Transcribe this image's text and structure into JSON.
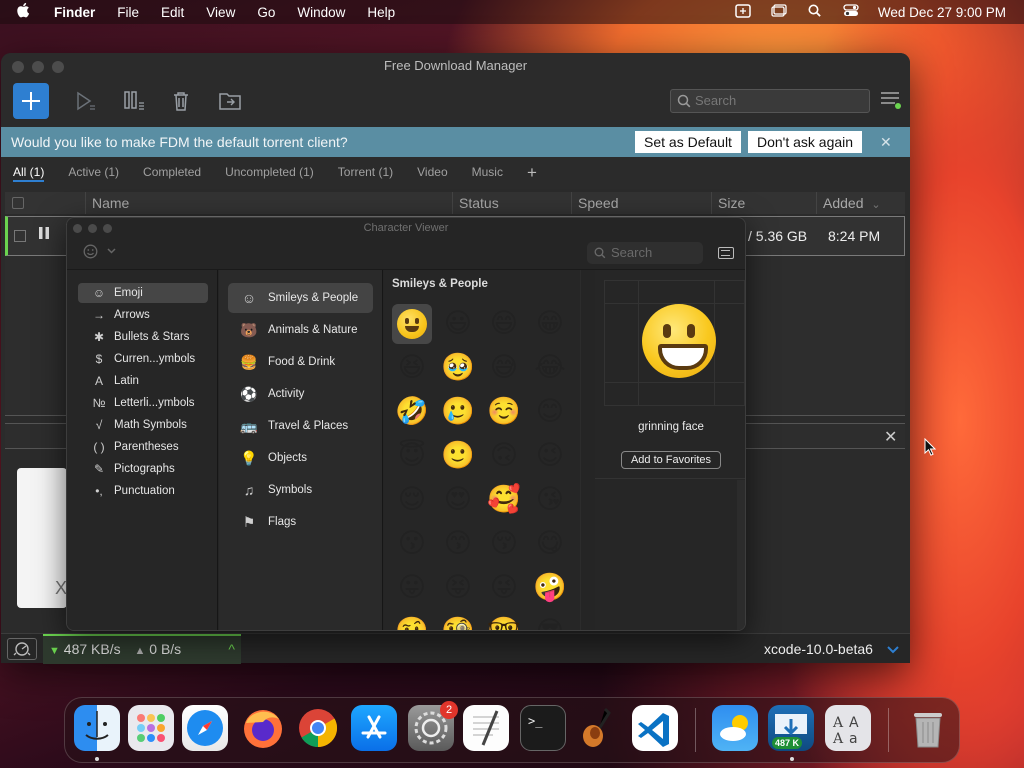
{
  "menubar": {
    "app_name": "Finder",
    "menus": [
      "File",
      "Edit",
      "View",
      "Go",
      "Window",
      "Help"
    ],
    "clock": "Wed Dec 27  9:00 PM",
    "status_icons": [
      "screen-mirror-icon",
      "window-icon",
      "search-icon",
      "control-center-icon"
    ]
  },
  "fdm": {
    "title": "Free Download Manager",
    "search_placeholder": "Search",
    "notice": {
      "text": "Would you like to make FDM the default torrent client?",
      "set_default": "Set as Default",
      "dont_ask": "Don't ask again",
      "close": "✕"
    },
    "tabs": [
      "All (1)",
      "Active (1)",
      "Completed",
      "Uncompleted (1)",
      "Torrent (1)",
      "Video",
      "Music"
    ],
    "tab_add": "+",
    "columns": [
      "Name",
      "Status",
      "Speed",
      "Size",
      "Added"
    ],
    "added_sort": "⌄",
    "row": {
      "size": "/ 5.36 GB",
      "added": "8:24 PM"
    },
    "detail_close": "✕",
    "detail_thumb_letter": "X",
    "statusbar": {
      "down": "487 KB/s",
      "up": "0 B/s",
      "file": "xcode-10.0-beta6"
    }
  },
  "char_viewer": {
    "title": "Character Viewer",
    "search_placeholder": "Search",
    "categories": [
      "Emoji",
      "Arrows",
      "Bullets & Stars",
      "Curren...ymbols",
      "Latin",
      "Letterli...ymbols",
      "Math Symbols",
      "Parentheses",
      "Pictographs",
      "Punctuation"
    ],
    "category_icons": [
      "☺",
      "→",
      "✱",
      "$",
      "A",
      "№",
      "√",
      "( )",
      "✎",
      "•,"
    ],
    "subcategories": [
      "Smileys & People",
      "Animals & Nature",
      "Food & Drink",
      "Activity",
      "Travel & Places",
      "Objects",
      "Symbols",
      "Flags"
    ],
    "subcategory_icons": [
      "☺",
      "🐻",
      "🍔",
      "⚽",
      "🚌",
      "💡",
      "♫",
      "⚑"
    ],
    "section_header": "Smileys & People",
    "emojis": [
      "😀",
      "😃",
      "😄",
      "😁",
      "😆",
      "🥹",
      "😅",
      "😂",
      "🤣",
      "🥲",
      "☺️",
      "😊",
      "😇",
      "🙂",
      "🙃",
      "😉",
      "😌",
      "😍",
      "🥰",
      "😘",
      "😗",
      "😙",
      "😚",
      "😋",
      "😛",
      "😝",
      "😜",
      "🤪",
      "🤨",
      "🧐",
      "🤓",
      "😎"
    ],
    "selected_name": "grinning face",
    "add_favorites": "Add to Favorites"
  },
  "dock": {
    "apps": [
      "Finder",
      "Launchpad",
      "Safari",
      "Firefox",
      "Chrome",
      "App Store",
      "System Preferences",
      "TextEdit",
      "Terminal",
      "GarageBand",
      "VS Code",
      "Weather",
      "Free Download Manager",
      "Font Book",
      "Trash"
    ],
    "settings_badge": "2",
    "fdm_badge": "487 K",
    "terminal_prompt": ">_"
  }
}
